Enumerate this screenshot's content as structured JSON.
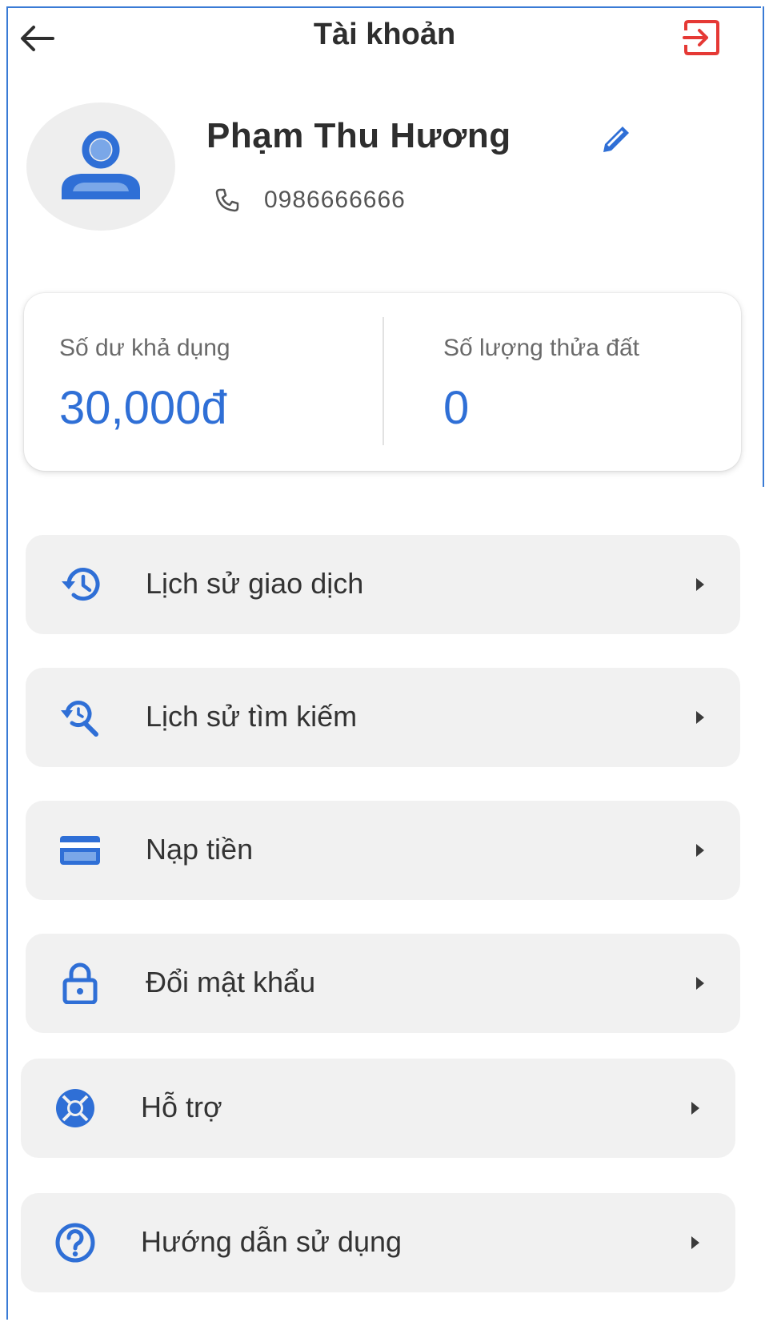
{
  "header": {
    "title": "Tài khoản",
    "back_icon": "arrow-left-icon",
    "logout_icon": "logout-icon"
  },
  "profile": {
    "name": "Phạm Thu Hương",
    "phone": "0986666666",
    "avatar_icon": "person-icon",
    "edit_icon": "pencil-icon",
    "phone_icon": "phone-icon"
  },
  "stats": {
    "balance_label": "Số dư khả dụng",
    "balance_value": "30,000đ",
    "plots_label": "Số lượng thửa đất",
    "plots_value": "0"
  },
  "menu": [
    {
      "label": "Lịch sử giao dịch",
      "icon": "history-icon"
    },
    {
      "label": "Lịch sử tìm kiếm",
      "icon": "search-history-icon"
    },
    {
      "label": "Nạp tiền",
      "icon": "credit-card-icon"
    },
    {
      "label": "Đổi mật khẩu",
      "icon": "lock-icon"
    },
    {
      "label": "Hỗ trợ",
      "icon": "support-icon"
    },
    {
      "label": "Hướng dẫn sử dụng",
      "icon": "help-icon"
    }
  ],
  "colors": {
    "accent": "#2f6fd6",
    "logout": "#e53935",
    "menu_bg": "#f1f1f1",
    "avatar_bg": "#eeeeee"
  }
}
